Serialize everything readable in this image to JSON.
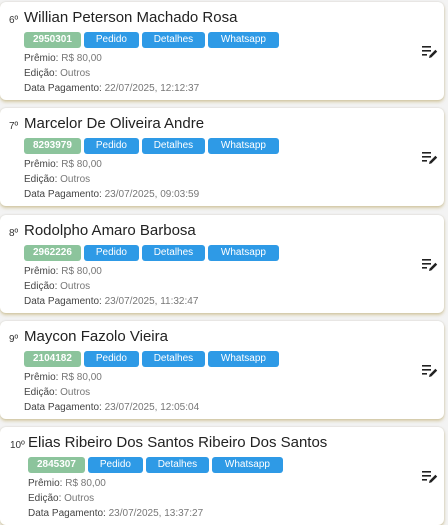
{
  "labels": {
    "premio": "Prêmio:",
    "edicao": "Edição:",
    "data_pagamento": "Data Pagamento:"
  },
  "entries": [
    {
      "rank": "6º",
      "name": "Willian Peterson Machado Rosa",
      "code": "2950301",
      "pedido": "Pedido",
      "detalhes": "Detalhes",
      "whatsapp": "Whatsapp",
      "premio": "R$ 80,00",
      "edicao": "Outros",
      "data_pagamento": "22/07/2025, 12:12:37"
    },
    {
      "rank": "7º",
      "name": "Marcelor De Oliveira Andre",
      "code": "8293979",
      "pedido": "Pedido",
      "detalhes": "Detalhes",
      "whatsapp": "Whatsapp",
      "premio": "R$ 80,00",
      "edicao": "Outros",
      "data_pagamento": "23/07/2025, 09:03:59"
    },
    {
      "rank": "8º",
      "name": "Rodolpho Amaro Barbosa",
      "code": "2962226",
      "pedido": "Pedido",
      "detalhes": "Detalhes",
      "whatsapp": "Whatsapp",
      "premio": "R$ 80,00",
      "edicao": "Outros",
      "data_pagamento": "23/07/2025, 11:32:47"
    },
    {
      "rank": "9º",
      "name": "Maycon Fazolo Vieira",
      "code": "2104182",
      "pedido": "Pedido",
      "detalhes": "Detalhes",
      "whatsapp": "Whatsapp",
      "premio": "R$ 80,00",
      "edicao": "Outros",
      "data_pagamento": "23/07/2025, 12:05:04"
    },
    {
      "rank": "10º",
      "name": "Elias Ribeiro Dos Santos Ribeiro Dos Santos",
      "code": "2845307",
      "pedido": "Pedido",
      "detalhes": "Detalhes",
      "whatsapp": "Whatsapp",
      "premio": "R$ 80,00",
      "edicao": "Outros",
      "data_pagamento": "23/07/2025, 13:37:27"
    }
  ],
  "colors": {
    "code_badge": "#8cc49c",
    "button": "#2e9ae6",
    "card_shadow": "#d8cc9a"
  },
  "icons": {
    "edit": "edit-list-icon"
  }
}
